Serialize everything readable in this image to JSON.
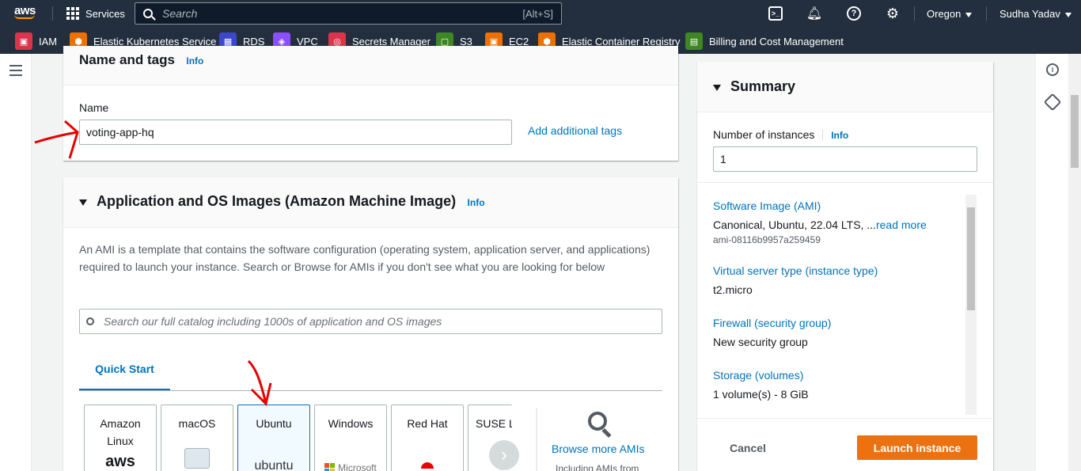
{
  "topbar": {
    "logo": "aws",
    "services_label": "Services",
    "search_placeholder": "Search",
    "search_shortcut": "[Alt+S]",
    "region": "Oregon",
    "user": "Sudha Yadav"
  },
  "favorites": [
    {
      "label": "IAM",
      "icon": "iam-icon",
      "color": "#dd344c"
    },
    {
      "label": "Elastic Kubernetes Service",
      "icon": "eks-icon",
      "color": "#ed7100"
    },
    {
      "label": "RDS",
      "icon": "rds-icon",
      "color": "#3b48cc"
    },
    {
      "label": "VPC",
      "icon": "vpc-icon",
      "color": "#8c4fff"
    },
    {
      "label": "Secrets Manager",
      "icon": "secrets-manager-icon",
      "color": "#dd344c"
    },
    {
      "label": "S3",
      "icon": "s3-icon",
      "color": "#3f8624"
    },
    {
      "label": "EC2",
      "icon": "ec2-icon",
      "color": "#ed7100"
    },
    {
      "label": "Elastic Container Registry",
      "icon": "ecr-icon",
      "color": "#ed7100"
    },
    {
      "label": "Billing and Cost Management",
      "icon": "billing-icon",
      "color": "#3f8624"
    }
  ],
  "name_tags": {
    "title": "Name and tags",
    "info": "Info",
    "name_label": "Name",
    "name_value": "voting-app-hq",
    "add_tags": "Add additional tags"
  },
  "ami": {
    "title": "Application and OS Images (Amazon Machine Image)",
    "info": "Info",
    "description": "An AMI is a template that contains the software configuration (operating system, application server, and applications) required to launch your instance. Search or Browse for AMIs if you don't see what you are looking for below",
    "search_placeholder": "Search our full catalog including 1000s of application and OS images",
    "tab_quick_start": "Quick Start",
    "tiles": [
      {
        "label": "Amazon Linux",
        "logo": "aws"
      },
      {
        "label": "macOS",
        "logo": ""
      },
      {
        "label": "Ubuntu",
        "logo": "ubuntu"
      },
      {
        "label": "Windows",
        "logo": "Microsoft"
      },
      {
        "label": "Red Hat",
        "logo": ""
      },
      {
        "label": "SUSE Li",
        "logo": ""
      }
    ],
    "browse_more": "Browse more AMIs",
    "browse_sub": "Including AMIs from"
  },
  "summary": {
    "title": "Summary",
    "instances_label": "Number of instances",
    "info": "Info",
    "instances_value": "1",
    "software_image_label": "Software Image (AMI)",
    "software_image_value": "Canonical, Ubuntu, 22.04 LTS, ...",
    "read_more": "read more",
    "ami_id": "ami-08116b9957a259459",
    "server_type_label": "Virtual server type (instance type)",
    "server_type_value": "t2.micro",
    "firewall_label": "Firewall (security group)",
    "firewall_value": "New security group",
    "storage_label": "Storage (volumes)",
    "storage_value": "1 volume(s) - 8 GiB",
    "cancel": "Cancel",
    "launch": "Launch instance"
  }
}
